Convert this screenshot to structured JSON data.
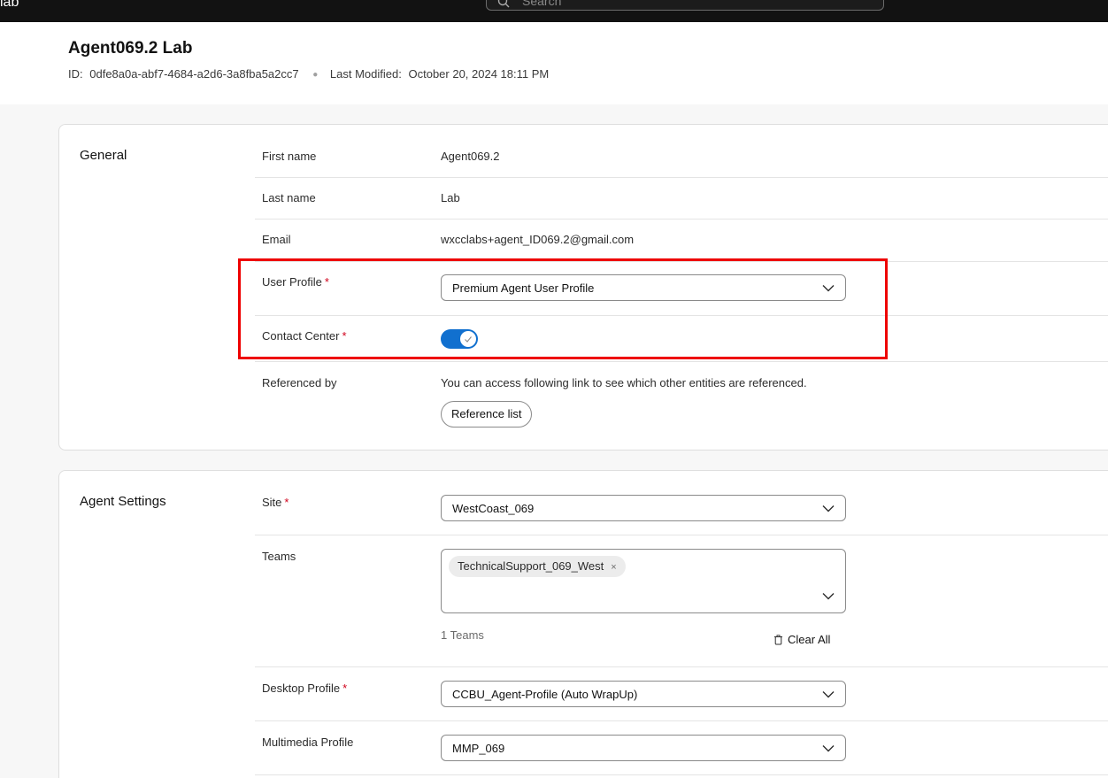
{
  "topbar": {
    "brand": "lab",
    "search_placeholder": "Search"
  },
  "header": {
    "title": "Agent069.2 Lab",
    "id_label": "ID:",
    "id_value": "0dfe8a0a-abf7-4684-a2d6-3a8fba5a2cc7",
    "modified_label": "Last Modified:",
    "modified_value": "October 20, 2024 18:11 PM"
  },
  "general": {
    "section_title": "General",
    "first_name_label": "First name",
    "first_name_value": "Agent069.2",
    "last_name_label": "Last name",
    "last_name_value": "Lab",
    "email_label": "Email",
    "email_value": "wxcclabs+agent_ID069.2@gmail.com",
    "user_profile_label": "User Profile",
    "user_profile_value": "Premium Agent User Profile",
    "contact_center_label": "Contact Center",
    "contact_center_enabled": true,
    "referenced_label": "Referenced by",
    "referenced_text": "You can access following link to see which other entities are referenced.",
    "reference_button": "Reference list",
    "required_mark": "*"
  },
  "agent_settings": {
    "section_title": "Agent Settings",
    "site_label": "Site",
    "site_value": "WestCoast_069",
    "teams_label": "Teams",
    "teams": [
      "TechnicalSupport_069_West"
    ],
    "chip_remove": "×",
    "teams_count": "1 Teams",
    "clear_all": "Clear All",
    "desktop_profile_label": "Desktop Profile",
    "desktop_profile_value": "CCBU_Agent-Profile (Auto WrapUp)",
    "multimedia_profile_label": "Multimedia Profile",
    "multimedia_profile_value": "MMP_069"
  },
  "colors": {
    "highlight": "#ee0000",
    "toggle_on": "#1170cf",
    "required": "#d0021b"
  }
}
